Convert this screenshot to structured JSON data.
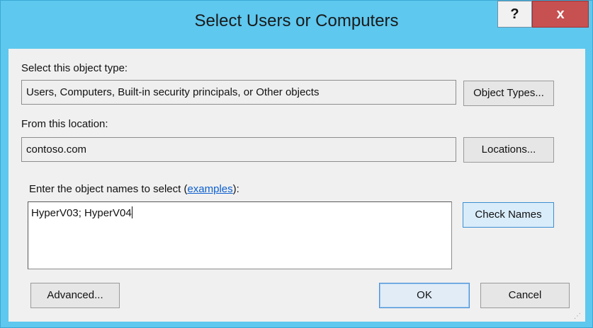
{
  "window": {
    "title": "Select Users or Computers",
    "help_label": "?",
    "close_label": "x"
  },
  "object_type": {
    "label": "Select this object type:",
    "value": "Users, Computers, Built-in security principals, or Other objects",
    "button": "Object Types..."
  },
  "location": {
    "label": "From this location:",
    "value": "contoso.com",
    "button": "Locations..."
  },
  "names": {
    "label_prefix": "Enter the object names to select (",
    "label_link": "examples",
    "label_suffix": "):",
    "value": "HyperV03; HyperV04",
    "check_button": "Check Names"
  },
  "footer": {
    "advanced_button": "Advanced...",
    "ok_button": "OK",
    "cancel_button": "Cancel"
  },
  "colors": {
    "title_bar": "#5ec8ef",
    "close_button": "#c75050",
    "link": "#0c5fcf"
  }
}
